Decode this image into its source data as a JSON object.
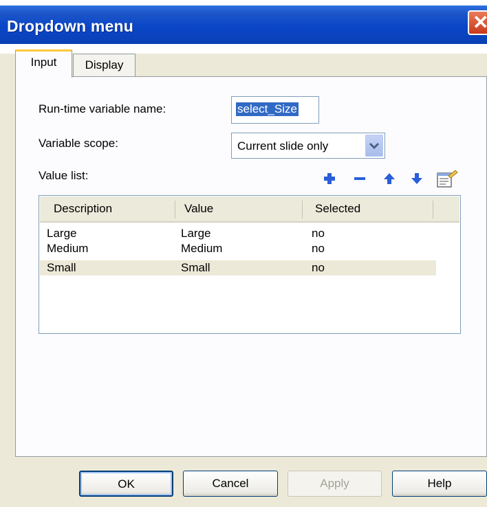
{
  "window": {
    "title": "Dropdown menu"
  },
  "tabs": [
    {
      "label": "Input"
    },
    {
      "label": "Display"
    }
  ],
  "form": {
    "runtime_label": "Run-time variable name:",
    "runtime_value": "select_Size",
    "scope_label": "Variable scope:",
    "scope_value": "Current slide only",
    "value_list_label": "Value list:"
  },
  "toolbar": {
    "icons": [
      "add-icon",
      "remove-icon",
      "move-up-icon",
      "move-down-icon",
      "properties-icon"
    ]
  },
  "table": {
    "headers": [
      "Description",
      "Value",
      "Selected"
    ],
    "rows": [
      [
        "Large",
        "Large",
        "no"
      ],
      [
        "Medium",
        "Medium",
        "no"
      ],
      [
        "Small",
        "Small",
        "no"
      ]
    ],
    "selected_row": 2
  },
  "buttons": {
    "ok": "OK",
    "cancel": "Cancel",
    "apply": "Apply",
    "help": "Help"
  },
  "colors": {
    "titlebar": "#0a46c7",
    "accent": "#ffc83c",
    "selection": "#316ac5",
    "toolbar_icons": "#2a5fd8"
  }
}
